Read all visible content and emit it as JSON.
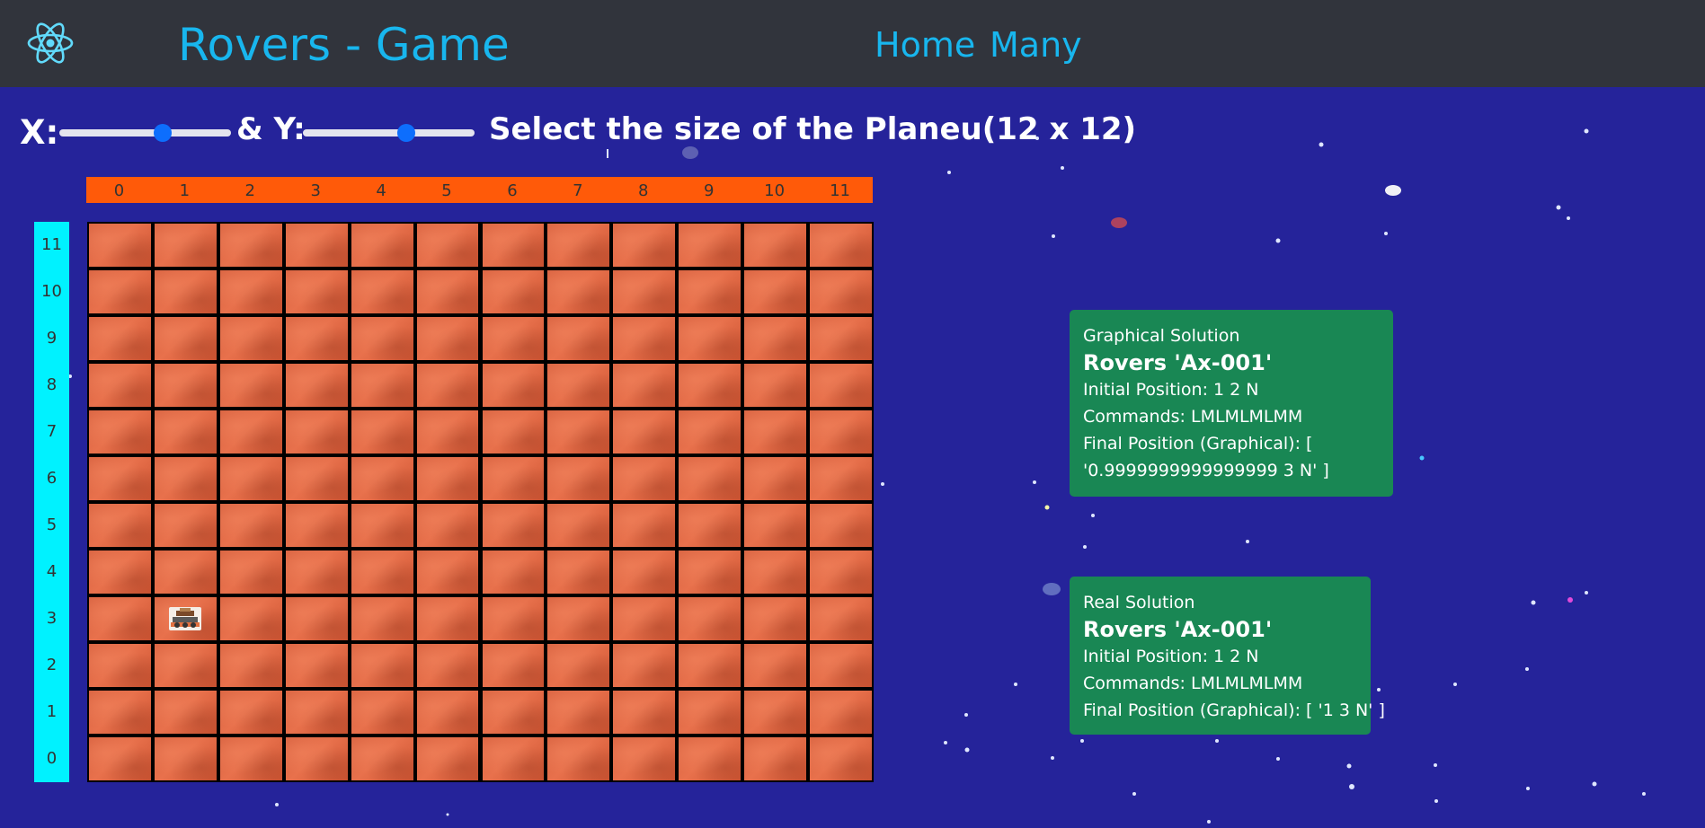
{
  "navbar": {
    "logo_icon": "react-atom-icon",
    "title": "Rovers - Game",
    "links": [
      "Home",
      "Many"
    ]
  },
  "controls": {
    "x_label": "X:",
    "y_label": "& Y:",
    "size_label": "Select the size of the Planeu(12 x 12)",
    "x_slider_fraction": 0.6,
    "y_slider_fraction": 0.6
  },
  "grid": {
    "columns": [
      "0",
      "1",
      "2",
      "3",
      "4",
      "5",
      "6",
      "7",
      "8",
      "9",
      "10",
      "11"
    ],
    "rows": [
      "11",
      "10",
      "9",
      "8",
      "7",
      "6",
      "5",
      "4",
      "3",
      "2",
      "1",
      "0"
    ],
    "rover_cell": {
      "x": 1,
      "y": 3
    }
  },
  "graphical_solution": {
    "heading": "Graphical Solution",
    "title": "Rovers 'Ax-001'",
    "initial_position": "Initial Position: 1 2 N",
    "commands": "Commands: LMLMLMLMM",
    "final_position_line1": "Final Position (Graphical): [",
    "final_position_line2": "'0.9999999999999999 3 N' ]"
  },
  "real_solution": {
    "heading": "Real Solution",
    "title": "Rovers 'Ax-001'",
    "initial_position": "Initial Position: 1 2 N",
    "commands": "Commands: LMLMLMLMM",
    "final_position": "Final Position (Graphical): [ '1 3 N' ]"
  },
  "colors": {
    "background": "#25239a",
    "navbar": "#31343c",
    "accent_text": "#18b6ee",
    "column_header": "#ff5a09",
    "row_header": "#00f2ff",
    "card": "#198754",
    "slider_thumb": "#0d6efd"
  }
}
